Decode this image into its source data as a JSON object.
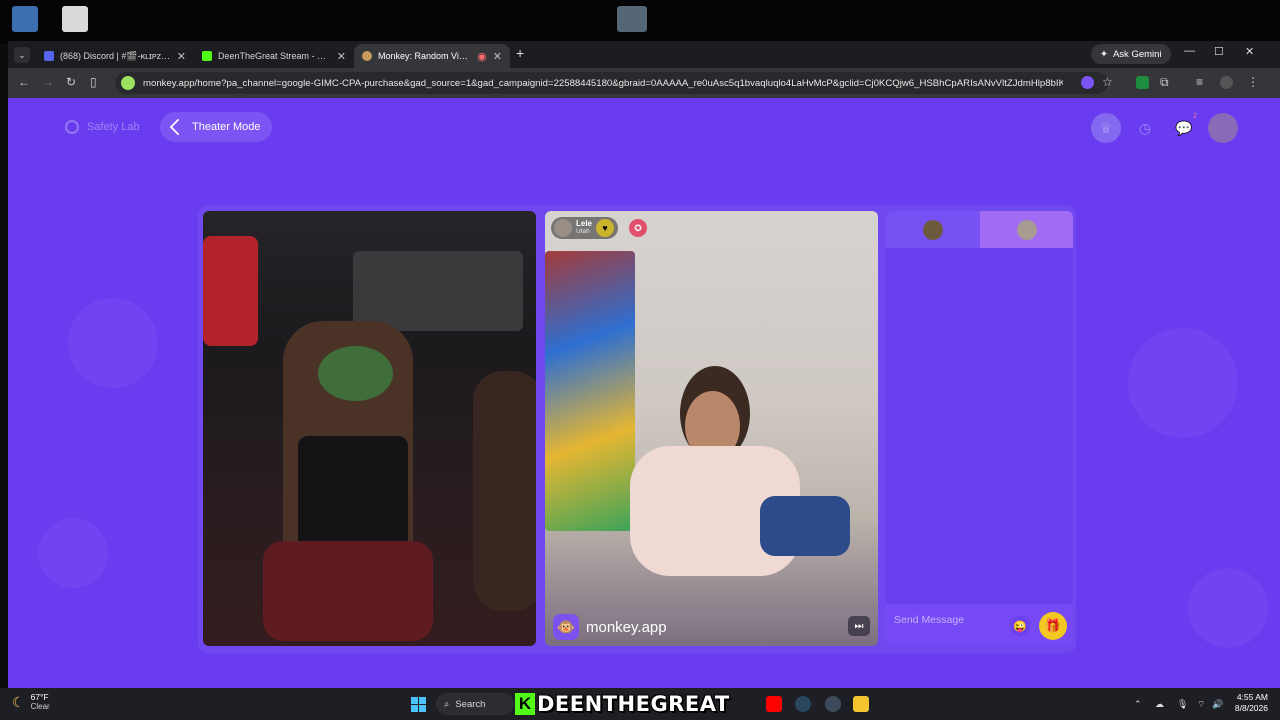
{
  "browser": {
    "tabs": [
      {
        "title": "(868) Discord | #🎬-ᴋʟɪᴘᴢ | Ꮥρ",
        "active": false
      },
      {
        "title": "DeenTheGreat Stream - Watch",
        "active": false
      },
      {
        "title": "Monkey: Random Video Ch",
        "active": true
      }
    ],
    "gemini_label": "Ask Gemini",
    "url": "monkey.app/home?pa_channel=google-GIMC-CPA-purchase&gad_source=1&gad_campaignid=22588445180&gbraid=0AAAAA_re0uAsc5q1bvaqluqlo4LaHvMcP&gclid=Cj0KCQjw6_HSBhCpARIsANvVltZJdmHlp8bIKVMAOeG..."
  },
  "page": {
    "safety_lab_label": "Safety Lab",
    "theater_mode_label": "Theater Mode",
    "notification_count": "2",
    "peer": {
      "name": "Lele",
      "location": "Utah"
    },
    "brand_text": "monkey.app",
    "chat_placeholder": "Send Message"
  },
  "taskbar": {
    "temperature": "67°F",
    "condition": "Clear",
    "search_label": "Search",
    "overlay_title": "DEENTHEGREAT",
    "overlay_k": "K",
    "time": "4:55 AM",
    "date": "8/8/2026"
  },
  "colors": {
    "page_bg": "#6a3cf0",
    "accent": "#7b54f3",
    "gift": "#f3c722",
    "kick_green": "#53fc18"
  }
}
